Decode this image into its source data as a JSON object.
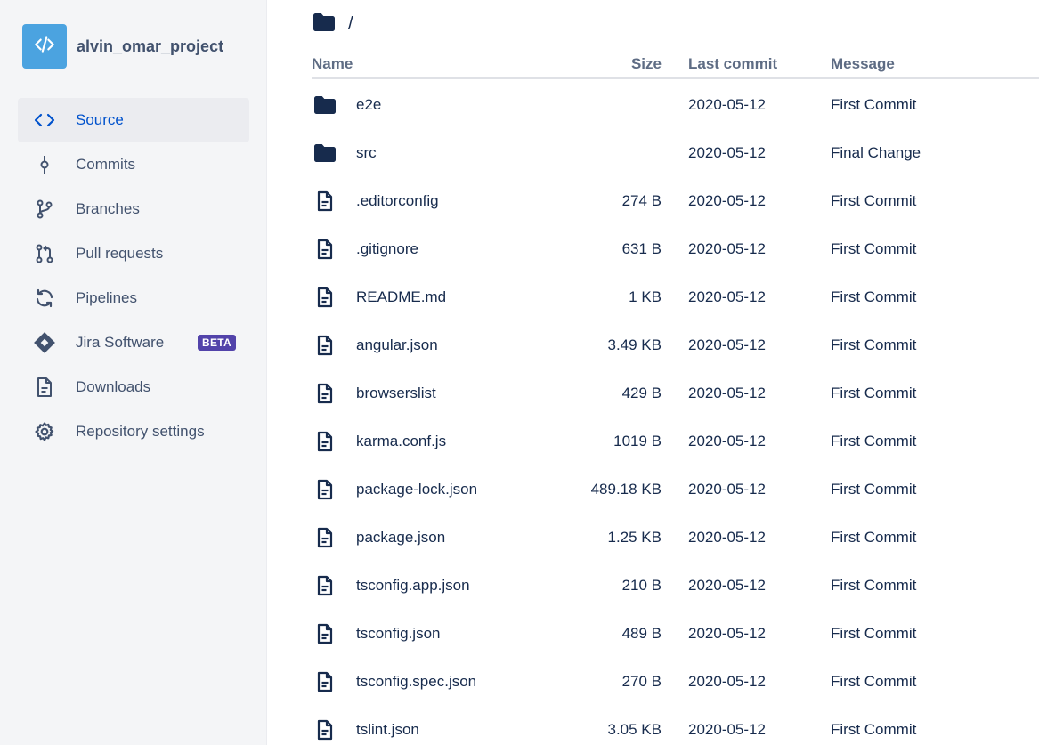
{
  "repo": {
    "name": "alvin_omar_project",
    "avatar_icon": "code-icon",
    "avatar_color": "#4BA3E0"
  },
  "nav": {
    "items": [
      {
        "key": "source",
        "label": "Source",
        "icon": "code-icon",
        "active": true
      },
      {
        "key": "commits",
        "label": "Commits",
        "icon": "commit-icon"
      },
      {
        "key": "branches",
        "label": "Branches",
        "icon": "branch-icon"
      },
      {
        "key": "pull-requests",
        "label": "Pull requests",
        "icon": "pull-request-icon"
      },
      {
        "key": "pipelines",
        "label": "Pipelines",
        "icon": "refresh-icon"
      },
      {
        "key": "jira-software",
        "label": "Jira Software",
        "icon": "jira-icon",
        "badge": "BETA"
      },
      {
        "key": "downloads",
        "label": "Downloads",
        "icon": "document-icon"
      },
      {
        "key": "repository-settings",
        "label": "Repository settings",
        "icon": "gear-icon"
      }
    ]
  },
  "path": {
    "label": "/"
  },
  "table": {
    "headers": {
      "name": "Name",
      "size": "Size",
      "last_commit": "Last commit",
      "message": "Message"
    },
    "rows": [
      {
        "type": "folder",
        "name": "e2e",
        "size": "",
        "date": "2020-05-12",
        "message": "First Commit"
      },
      {
        "type": "folder",
        "name": "src",
        "size": "",
        "date": "2020-05-12",
        "message": "Final Change"
      },
      {
        "type": "file",
        "name": ".editorconfig",
        "size": "274 B",
        "date": "2020-05-12",
        "message": "First Commit"
      },
      {
        "type": "file",
        "name": ".gitignore",
        "size": "631 B",
        "date": "2020-05-12",
        "message": "First Commit"
      },
      {
        "type": "file",
        "name": "README.md",
        "size": "1 KB",
        "date": "2020-05-12",
        "message": "First Commit"
      },
      {
        "type": "file",
        "name": "angular.json",
        "size": "3.49 KB",
        "date": "2020-05-12",
        "message": "First Commit"
      },
      {
        "type": "file",
        "name": "browserslist",
        "size": "429 B",
        "date": "2020-05-12",
        "message": "First Commit"
      },
      {
        "type": "file",
        "name": "karma.conf.js",
        "size": "1019 B",
        "date": "2020-05-12",
        "message": "First Commit"
      },
      {
        "type": "file",
        "name": "package-lock.json",
        "size": "489.18 KB",
        "date": "2020-05-12",
        "message": "First Commit"
      },
      {
        "type": "file",
        "name": "package.json",
        "size": "1.25 KB",
        "date": "2020-05-12",
        "message": "First Commit"
      },
      {
        "type": "file",
        "name": "tsconfig.app.json",
        "size": "210 B",
        "date": "2020-05-12",
        "message": "First Commit"
      },
      {
        "type": "file",
        "name": "tsconfig.json",
        "size": "489 B",
        "date": "2020-05-12",
        "message": "First Commit"
      },
      {
        "type": "file",
        "name": "tsconfig.spec.json",
        "size": "270 B",
        "date": "2020-05-12",
        "message": "First Commit"
      },
      {
        "type": "file",
        "name": "tslint.json",
        "size": "3.05 KB",
        "date": "2020-05-12",
        "message": "First Commit"
      }
    ]
  },
  "colors": {
    "accent": "#0052CC",
    "text": "#172B4D",
    "muted": "#42526E",
    "badge": "#5243AA",
    "sidebar_bg": "#F4F5F7"
  }
}
